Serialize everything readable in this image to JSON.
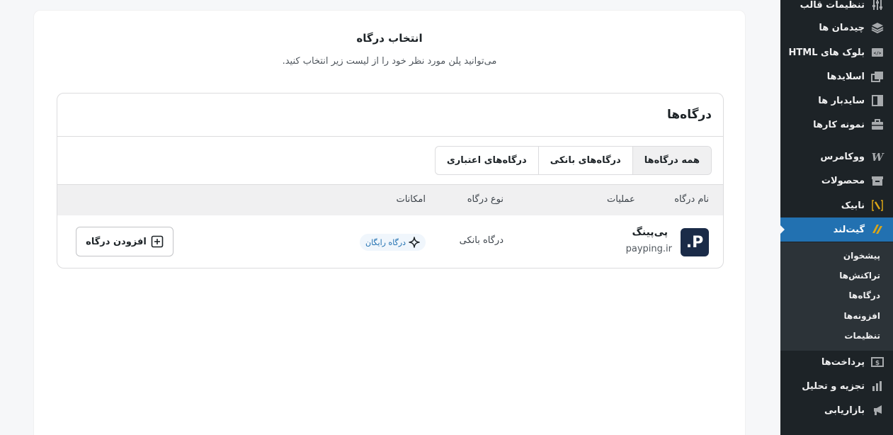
{
  "sidebar": {
    "items": [
      {
        "label": "تنظیمات قالب",
        "icon": "sliders-icon"
      },
      {
        "label": "چیدمان ها",
        "icon": "layers-icon"
      },
      {
        "label": "بلوک های HTML",
        "icon": "code-block-icon"
      },
      {
        "label": "اسلایدها",
        "icon": "slides-icon"
      },
      {
        "label": "سایدبار ها",
        "icon": "sidebar-icon"
      },
      {
        "label": "نمونه کارها",
        "icon": "briefcase-icon"
      },
      {
        "label": "ووکامرس",
        "icon": "woocommerce-icon"
      },
      {
        "label": "محصولات",
        "icon": "archive-icon"
      },
      {
        "label": "نابیک",
        "icon": "nabik-icon"
      },
      {
        "label": "گیت‌لند",
        "icon": "gateland-icon",
        "active": true
      },
      {
        "label": "پرداخت‌ها",
        "icon": "payment-icon"
      },
      {
        "label": "تجزیه و تحلیل",
        "icon": "chart-icon"
      },
      {
        "label": "بازاریابی",
        "icon": "megaphone-icon"
      }
    ],
    "submenu": [
      {
        "label": "پیشخوان"
      },
      {
        "label": "تراکنش‌ها"
      },
      {
        "label": "درگاه‌ها"
      },
      {
        "label": "افزونه‌ها"
      },
      {
        "label": "تنظیمات"
      }
    ]
  },
  "page": {
    "title": "انتخاب درگاه",
    "subtitle": "می‌توانید پلن مورد نظر خود را از لیست زیر انتخاب کنید."
  },
  "gateways": {
    "heading": "درگاه‌ها",
    "tabs": [
      {
        "label": "همه درگاه‌ها",
        "active": true
      },
      {
        "label": "درگاه‌های بانکی"
      },
      {
        "label": "درگاه‌های اعتباری"
      }
    ],
    "columns": {
      "name": "نام درگاه",
      "type": "نوع درگاه",
      "features": "امکانات",
      "actions": "عملیات"
    },
    "rows": [
      {
        "logo_letter": "P.",
        "name": "پی‌پینگ",
        "domain": "payping.ir",
        "type": "درگاه بانکی",
        "feature": "درگاه رایگان",
        "action": "افزودن درگاه"
      }
    ]
  },
  "colors": {
    "sidebar_bg": "#1d2327",
    "active_bg": "#2271b1",
    "logo_bg": "#1a2b48"
  }
}
